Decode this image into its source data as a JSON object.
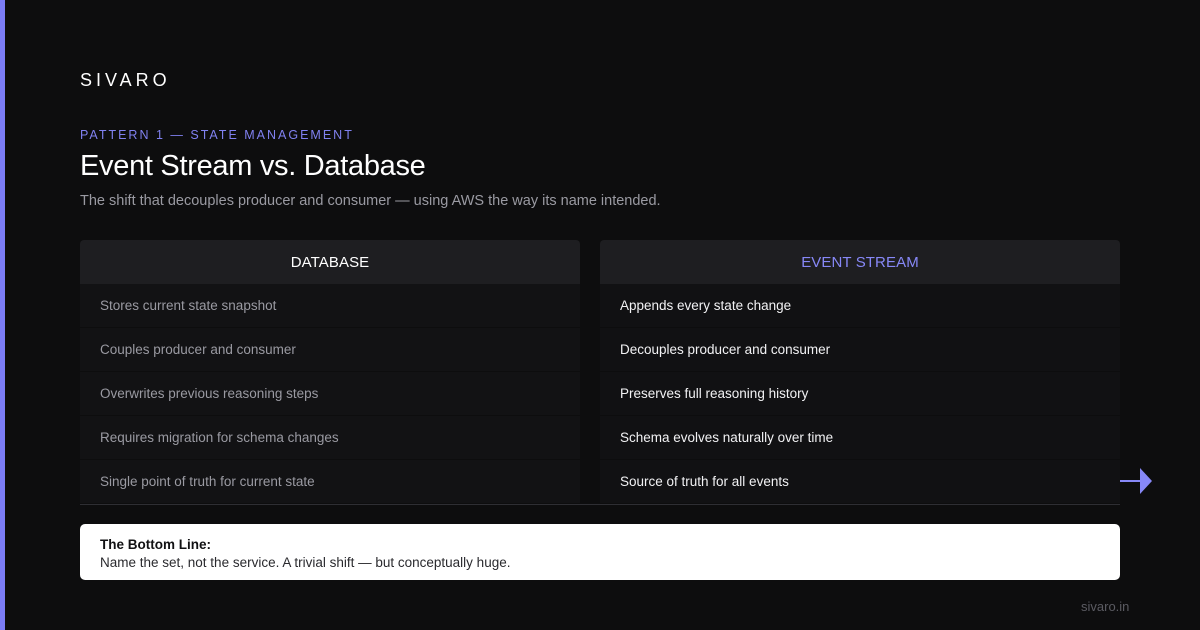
{
  "brand": "SIVARO",
  "eyebrow": "PATTERN 1 — STATE MANAGEMENT",
  "title": "Event Stream vs. Database",
  "subtitle": "The shift that decouples producer and consumer — using AWS the way its name intended.",
  "columns": {
    "left": {
      "header": "DATABASE",
      "rows": [
        "Stores current state snapshot",
        "Couples producer and consumer",
        "Overwrites previous reasoning steps",
        "Requires migration for schema changes",
        "Single point of truth for current state"
      ]
    },
    "right": {
      "header": "EVENT STREAM",
      "rows": [
        "Appends every state change",
        "Decouples producer and consumer",
        "Preserves full reasoning history",
        "Schema evolves naturally over time",
        "Source of truth for all events"
      ]
    }
  },
  "callout": {
    "heading": "The Bottom Line:",
    "body": "Name the set, not the service. A trivial shift — but conceptually huge."
  },
  "footer": {
    "url": "sivaro.in"
  },
  "icons": {
    "next": "arrow-right-icon"
  },
  "colors": {
    "accent": "#7b7cf5",
    "background": "#0d0d0e",
    "header_bg": "#1e1e21"
  }
}
